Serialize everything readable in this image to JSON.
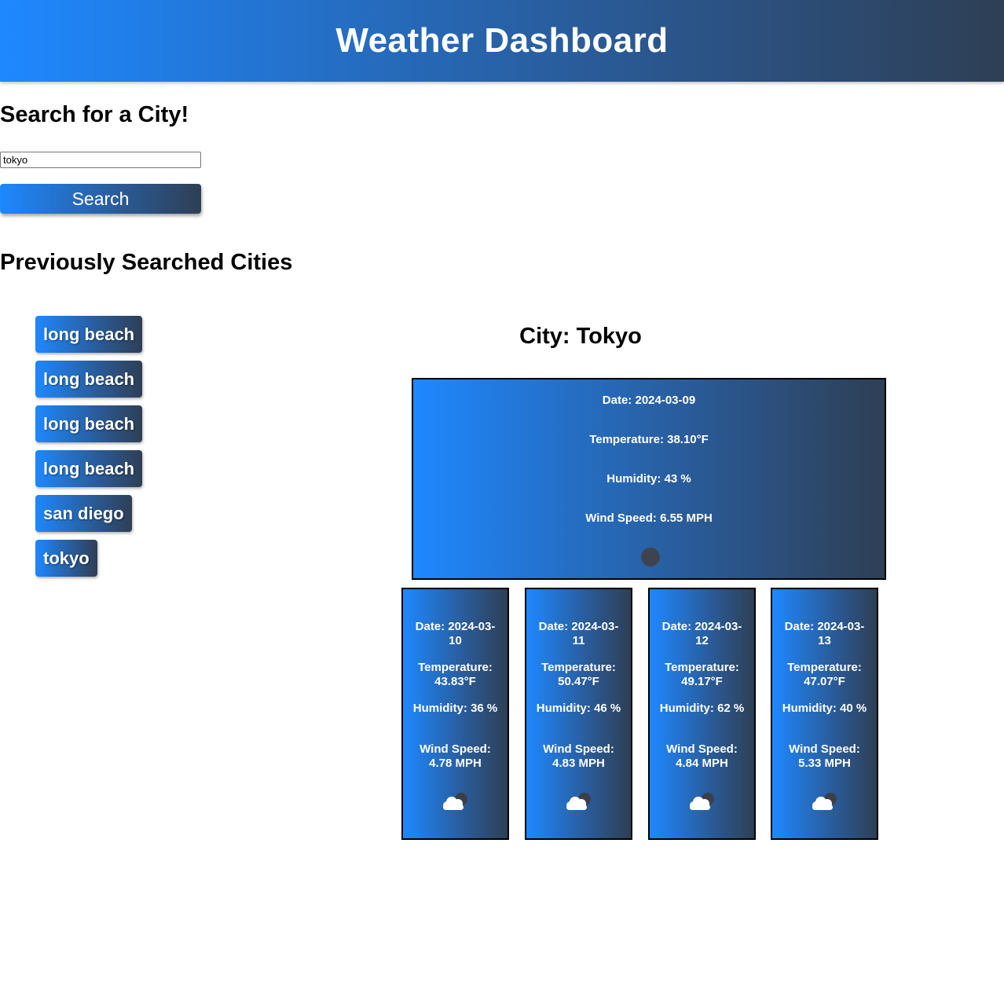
{
  "header": {
    "title": "Weather Dashboard"
  },
  "search": {
    "title": "Search for a City!",
    "input_value": "tokyo",
    "button_label": "Search"
  },
  "history": {
    "title": "Previously Searched Cities",
    "cities": [
      "long beach",
      "long beach",
      "long beach",
      "long beach",
      "san diego",
      "tokyo"
    ]
  },
  "current": {
    "city_label": "City: Tokyo",
    "date": "Date: 2024-03-09",
    "temperature": "Temperature: 38.10°F",
    "humidity": "Humidity: 43 %",
    "wind": "Wind Speed: 6.55 MPH",
    "icon": "weather-icon"
  },
  "forecast": [
    {
      "date": "Date: 2024-03-10",
      "temperature": "Temperature: 43.83°F",
      "humidity": "Humidity: 36 %",
      "wind": "Wind Speed: 4.78 MPH",
      "icon": "cloud-icon"
    },
    {
      "date": "Date: 2024-03-11",
      "temperature": "Temperature: 50.47°F",
      "humidity": "Humidity: 46 %",
      "wind": "Wind Speed: 4.83 MPH",
      "icon": "cloud-icon"
    },
    {
      "date": "Date: 2024-03-12",
      "temperature": "Temperature: 49.17°F",
      "humidity": "Humidity: 62 %",
      "wind": "Wind Speed: 4.84 MPH",
      "icon": "cloud-icon"
    },
    {
      "date": "Date: 2024-03-13",
      "temperature": "Temperature: 47.07°F",
      "humidity": "Humidity: 40 %",
      "wind": "Wind Speed: 5.33 MPH",
      "icon": "cloud-icon"
    }
  ],
  "colors": {
    "gradient_start": "#1e88ff",
    "gradient_end": "#2e3f55",
    "text_on_gradient": "#ffffff"
  }
}
